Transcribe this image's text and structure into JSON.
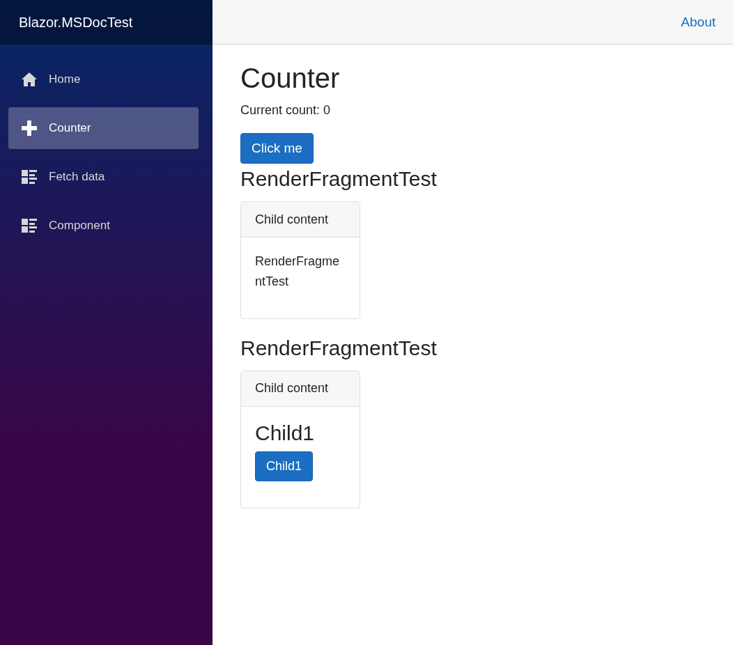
{
  "brand": "Blazor.MSDocTest",
  "nav": [
    {
      "label": "Home",
      "kind": "home",
      "selected": false
    },
    {
      "label": "Counter",
      "kind": "plus",
      "selected": true
    },
    {
      "label": "Fetch data",
      "kind": "list",
      "selected": false
    },
    {
      "label": "Component",
      "kind": "list",
      "selected": false
    }
  ],
  "top_link": "About",
  "title": "Counter",
  "count_text": "Current count: 0",
  "button": "Click me",
  "sections": [
    {
      "title": "RenderFragmentTest",
      "card_header": "Child content",
      "body": [
        {
          "kind": "text",
          "text": "RenderFragmentTest"
        }
      ]
    },
    {
      "title": "RenderFragmentTest",
      "card_header": "Child content",
      "body": [
        {
          "kind": "heading",
          "text": "Child1"
        },
        {
          "kind": "button",
          "text": "Child1"
        }
      ]
    }
  ]
}
